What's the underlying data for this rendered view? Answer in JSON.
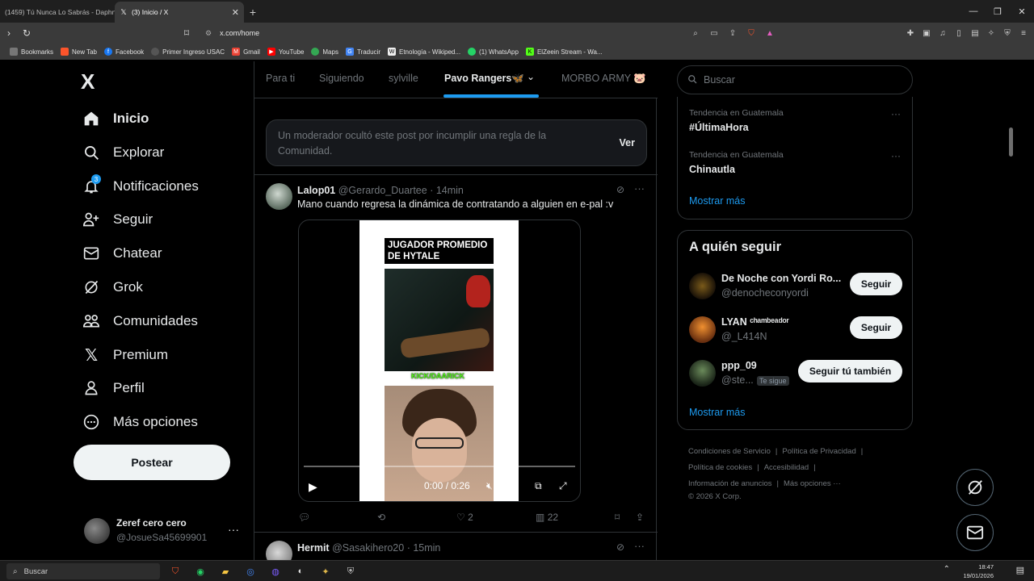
{
  "browser": {
    "tabs": [
      {
        "title": "(1459) Tú Nunca Lo Sabrás - Daphne",
        "active": false
      },
      {
        "title": "(3) Inicio / X",
        "active": true
      }
    ],
    "url": "x.com/home",
    "bookmarks": [
      "Bookmarks",
      "New Tab",
      "Facebook",
      "Primer Ingreso USAC",
      "Gmail",
      "YouTube",
      "Maps",
      "Traducir",
      "Etnología - Wikiped...",
      "(1) WhatsApp",
      "ElZeein Stream - Wa..."
    ]
  },
  "sidebar": {
    "logo": "X",
    "items": [
      {
        "label": "Inicio",
        "icon": "home-icon"
      },
      {
        "label": "Explorar",
        "icon": "search-icon"
      },
      {
        "label": "Notificaciones",
        "icon": "bell-icon"
      },
      {
        "label": "Seguir",
        "icon": "person-add-icon"
      },
      {
        "label": "Chatear",
        "icon": "mail-icon"
      },
      {
        "label": "Grok",
        "icon": "grok-icon"
      },
      {
        "label": "Comunidades",
        "icon": "communities-icon"
      },
      {
        "label": "Premium",
        "icon": "x-premium-icon"
      },
      {
        "label": "Perfil",
        "icon": "person-icon"
      },
      {
        "label": "Más opciones",
        "icon": "more-circle-icon"
      }
    ],
    "notification_badge": "3",
    "post_button": "Postear",
    "account": {
      "name": "Zeref cero cero",
      "handle": "@JosueSa45699901"
    }
  },
  "timeline": {
    "tabs": [
      "Para ti",
      "Siguiendo",
      "sylville",
      "Pavo Rangers🦋",
      "MORBO ARMY 🐷"
    ],
    "active_tab": "Pavo Rangers🦋",
    "moderation": {
      "text": "Un moderador ocultó este post por incumplir una regla de la Comunidad.",
      "action": "Ver"
    },
    "post1": {
      "name": "Lalop01",
      "handle": "@Gerardo_Duartee",
      "time": "· 14min",
      "text": "Mano cuando regresa la dinámica de contratando a alguien en e-pal :v",
      "video": {
        "title": "JUGADOR PROMEDIO DE HYTALE",
        "caption": "KICK/DAARICK",
        "time": "0:00 / 0:26"
      },
      "likes": "2",
      "views": "22"
    },
    "post2": {
      "name": "Hermit",
      "handle": "@Sasakihero20",
      "time": "· 15min"
    }
  },
  "right": {
    "search_placeholder": "Buscar",
    "trends": [
      {
        "context": "Tendencia en Guatemala",
        "topic": "#ÚltimaHora"
      },
      {
        "context": "Tendencia en Guatemala",
        "topic": "Chinautla"
      }
    ],
    "show_more": "Mostrar más",
    "who_title": "A quién seguir",
    "who": [
      {
        "name": "De Noche con Yordi Ro...",
        "handle": "@denocheconyordi",
        "button": "Seguir",
        "tag": ""
      },
      {
        "name": "LYAN ᶜʰᵃᵐᵇᵉᵃᵈᵒʳ",
        "handle": "@_L414N",
        "button": "Seguir",
        "tag": ""
      },
      {
        "name": "ppp_09",
        "handle": "@ste...",
        "button": "Seguir tú también",
        "tag": "Te sigue"
      }
    ],
    "who_more": "Mostrar más",
    "footer": {
      "l1a": "Condiciones de Servicio",
      "l1b": "Política de Privacidad",
      "l2a": "Política de cookies",
      "l2b": "Accesibilidad",
      "l3a": "Información de anuncios",
      "l3b": "Más opciones ···",
      "copy": "© 2026 X Corp."
    }
  },
  "taskbar": {
    "search": "Buscar",
    "time": "18:47",
    "date": "19/01/2026"
  },
  "colors": {
    "accent": "#1d9bf0",
    "background": "#000000",
    "border": "#2f3336",
    "muted": "#71767b"
  }
}
